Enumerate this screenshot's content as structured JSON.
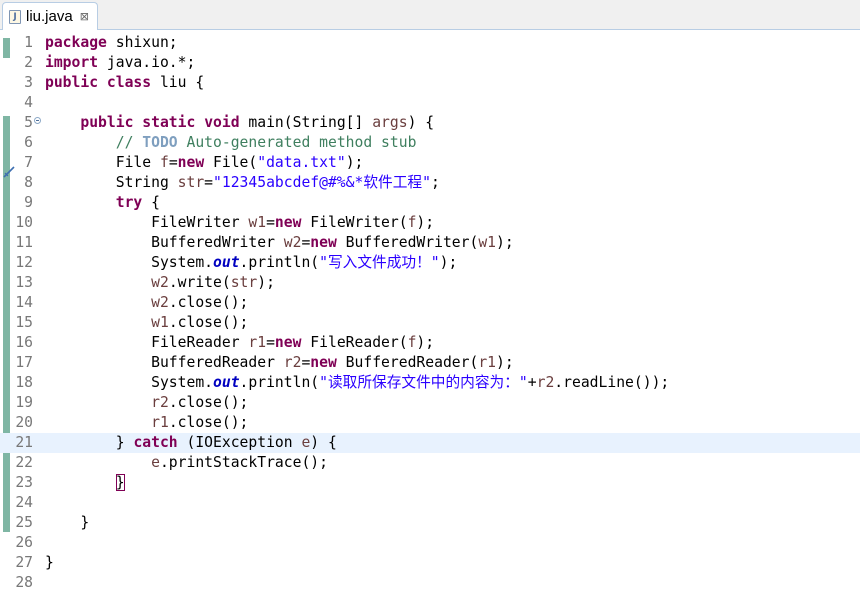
{
  "tab": {
    "file_icon": "J",
    "title": "liu.java",
    "close_glyph": "⊠"
  },
  "editor": {
    "current_line": 21,
    "lines": [
      {
        "n": "1",
        "tokens": [
          {
            "t": "package",
            "c": "kw"
          },
          {
            "t": " shixun;"
          }
        ]
      },
      {
        "n": "2",
        "tokens": [
          {
            "t": "import",
            "c": "kw"
          },
          {
            "t": " java.io.*;"
          }
        ]
      },
      {
        "n": "3",
        "tokens": [
          {
            "t": "public",
            "c": "kw"
          },
          {
            "t": " "
          },
          {
            "t": "class",
            "c": "kw"
          },
          {
            "t": " liu {"
          }
        ]
      },
      {
        "n": "4",
        "tokens": []
      },
      {
        "n": "5",
        "fold": true,
        "tokens": [
          {
            "t": "    "
          },
          {
            "t": "public",
            "c": "kw"
          },
          {
            "t": " "
          },
          {
            "t": "static",
            "c": "kw"
          },
          {
            "t": " "
          },
          {
            "t": "void",
            "c": "kw"
          },
          {
            "t": " main(String[] "
          },
          {
            "t": "args",
            "c": "var"
          },
          {
            "t": ") {"
          }
        ]
      },
      {
        "n": "6",
        "tokens": [
          {
            "t": "        "
          },
          {
            "t": "// ",
            "c": "cmt"
          },
          {
            "t": "TODO",
            "c": "todo"
          },
          {
            "t": " Auto-generated method stub",
            "c": "cmt"
          }
        ]
      },
      {
        "n": "7",
        "tokens": [
          {
            "t": "        File "
          },
          {
            "t": "f",
            "c": "var"
          },
          {
            "t": "="
          },
          {
            "t": "new",
            "c": "kw"
          },
          {
            "t": " File("
          },
          {
            "t": "\"data.txt\"",
            "c": "str"
          },
          {
            "t": ");"
          }
        ]
      },
      {
        "n": "8",
        "tokens": [
          {
            "t": "        String "
          },
          {
            "t": "str",
            "c": "var"
          },
          {
            "t": "="
          },
          {
            "t": "\"12345abcdef@#%&*软件工程\"",
            "c": "str"
          },
          {
            "t": ";"
          }
        ]
      },
      {
        "n": "9",
        "tokens": [
          {
            "t": "        "
          },
          {
            "t": "try",
            "c": "kw"
          },
          {
            "t": " {"
          }
        ]
      },
      {
        "n": "10",
        "tokens": [
          {
            "t": "            FileWriter "
          },
          {
            "t": "w1",
            "c": "var"
          },
          {
            "t": "="
          },
          {
            "t": "new",
            "c": "kw"
          },
          {
            "t": " FileWriter("
          },
          {
            "t": "f",
            "c": "var"
          },
          {
            "t": ");"
          }
        ]
      },
      {
        "n": "11",
        "tokens": [
          {
            "t": "            BufferedWriter "
          },
          {
            "t": "w2",
            "c": "var"
          },
          {
            "t": "="
          },
          {
            "t": "new",
            "c": "kw"
          },
          {
            "t": " BufferedWriter("
          },
          {
            "t": "w1",
            "c": "var"
          },
          {
            "t": ");"
          }
        ]
      },
      {
        "n": "12",
        "tokens": [
          {
            "t": "            System."
          },
          {
            "t": "out",
            "c": "fld"
          },
          {
            "t": ".println("
          },
          {
            "t": "\"写入文件成功！\"",
            "c": "str"
          },
          {
            "t": ");"
          }
        ]
      },
      {
        "n": "13",
        "tokens": [
          {
            "t": "            "
          },
          {
            "t": "w2",
            "c": "var"
          },
          {
            "t": ".write("
          },
          {
            "t": "str",
            "c": "var"
          },
          {
            "t": ");"
          }
        ]
      },
      {
        "n": "14",
        "tokens": [
          {
            "t": "            "
          },
          {
            "t": "w2",
            "c": "var"
          },
          {
            "t": ".close();"
          }
        ]
      },
      {
        "n": "15",
        "tokens": [
          {
            "t": "            "
          },
          {
            "t": "w1",
            "c": "var"
          },
          {
            "t": ".close();"
          }
        ]
      },
      {
        "n": "16",
        "tokens": [
          {
            "t": "            FileReader "
          },
          {
            "t": "r1",
            "c": "var"
          },
          {
            "t": "="
          },
          {
            "t": "new",
            "c": "kw"
          },
          {
            "t": " FileReader("
          },
          {
            "t": "f",
            "c": "var"
          },
          {
            "t": ");"
          }
        ]
      },
      {
        "n": "17",
        "tokens": [
          {
            "t": "            BufferedReader "
          },
          {
            "t": "r2",
            "c": "var"
          },
          {
            "t": "="
          },
          {
            "t": "new",
            "c": "kw"
          },
          {
            "t": " BufferedReader("
          },
          {
            "t": "r1",
            "c": "var"
          },
          {
            "t": ");"
          }
        ]
      },
      {
        "n": "18",
        "tokens": [
          {
            "t": "            System."
          },
          {
            "t": "out",
            "c": "fld"
          },
          {
            "t": ".println("
          },
          {
            "t": "\"读取所保存文件中的内容为：\"",
            "c": "str"
          },
          {
            "t": "+"
          },
          {
            "t": "r2",
            "c": "var"
          },
          {
            "t": ".readLine());"
          }
        ]
      },
      {
        "n": "19",
        "tokens": [
          {
            "t": "            "
          },
          {
            "t": "r2",
            "c": "var"
          },
          {
            "t": ".close();"
          }
        ]
      },
      {
        "n": "20",
        "tokens": [
          {
            "t": "            "
          },
          {
            "t": "r1",
            "c": "var"
          },
          {
            "t": ".close();"
          }
        ]
      },
      {
        "n": "21",
        "tokens": [
          {
            "t": "        } "
          },
          {
            "t": "catch",
            "c": "kw"
          },
          {
            "t": " (IOException "
          },
          {
            "t": "e",
            "c": "var"
          },
          {
            "t": ") {"
          }
        ]
      },
      {
        "n": "22",
        "tokens": [
          {
            "t": "            "
          },
          {
            "t": "e",
            "c": "var"
          },
          {
            "t": ".printStackTrace();"
          }
        ]
      },
      {
        "n": "23",
        "tokens": [
          {
            "t": "        "
          },
          {
            "t": "}",
            "c": "brace-match"
          }
        ]
      },
      {
        "n": "24",
        "tokens": []
      },
      {
        "n": "25",
        "tokens": [
          {
            "t": "    }"
          }
        ]
      },
      {
        "n": "26",
        "tokens": []
      },
      {
        "n": "27",
        "tokens": [
          {
            "t": "}"
          }
        ]
      },
      {
        "n": "28",
        "tokens": []
      }
    ]
  },
  "colors": {
    "keyword": "#7f0055",
    "string": "#2a00ff",
    "comment": "#3f7f5f",
    "todo": "#7f9fbf",
    "field": "#0000c0",
    "variable": "#6a3e3e",
    "current_line": "#e8f2fe",
    "change_ruler": "#7fb6a4",
    "line_number": "#787878"
  },
  "icons": {
    "file": "java-file-icon",
    "close": "close-tab-icon",
    "fold": "collapse-icon",
    "override": "override-marker-icon"
  }
}
